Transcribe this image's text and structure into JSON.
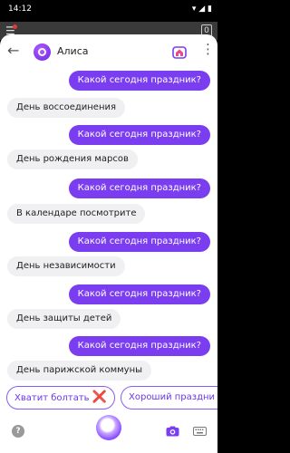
{
  "status_bar": {
    "time": "14:12",
    "icons_text": "▾ ◢ ▮"
  },
  "background": {
    "badge_count": "0"
  },
  "header": {
    "title": "Алиса"
  },
  "messages": [
    {
      "from": "user",
      "text": "Какой сегодня праздник?"
    },
    {
      "from": "bot",
      "text": "День воссоединения"
    },
    {
      "from": "user",
      "text": "Какой сегодня праздник?"
    },
    {
      "from": "bot",
      "text": "День рождения марсов"
    },
    {
      "from": "user",
      "text": "Какой сегодня праздник?"
    },
    {
      "from": "bot",
      "text": "В календаре посмотрите"
    },
    {
      "from": "user",
      "text": "Какой сегодня праздник?"
    },
    {
      "from": "bot",
      "text": "День независимости"
    },
    {
      "from": "user",
      "text": "Какой сегодня праздник?"
    },
    {
      "from": "bot",
      "text": "День защиты детей"
    },
    {
      "from": "user",
      "text": "Какой сегодня праздник?"
    },
    {
      "from": "bot",
      "text": "День парижской коммуны"
    }
  ],
  "suggestions": [
    {
      "label": "Хватит болтать",
      "emoji": "❌"
    },
    {
      "label": "Хороший праздни"
    }
  ],
  "bottom_bar": {
    "help_glyph": "?"
  },
  "colors": {
    "accent": "#7a3df0",
    "bot_bubble": "#f0f0f3",
    "chip_border": "#8a5cf0"
  }
}
